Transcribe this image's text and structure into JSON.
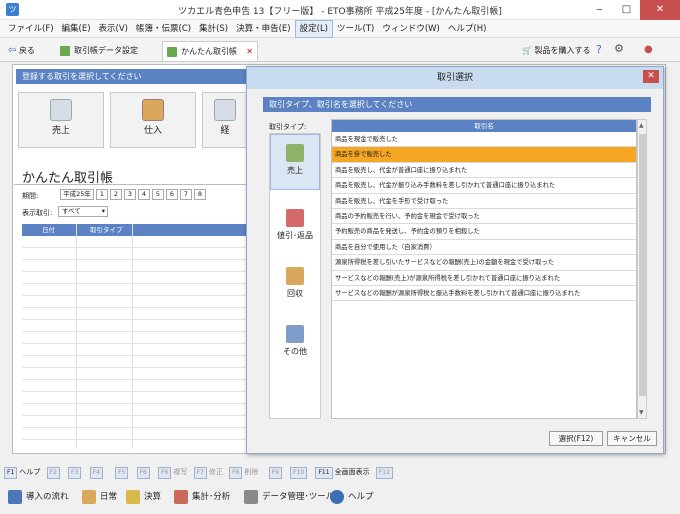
{
  "window": {
    "title": "ツカエル青色申告 13【フリー版】 - ETO事務所 平成25年度 - [かんたん取引帳]",
    "min_label": "‒",
    "max_label": "□",
    "close_label": "✕"
  },
  "menu": [
    "ファイル(F)",
    "編集(E)",
    "表示(V)",
    "帳簿・伝票(C)",
    "集計(S)",
    "決算・申告(E)",
    "設定(L)",
    "ツール(T)",
    "ウィンドウ(W)",
    "ヘルプ(H)"
  ],
  "toolbar": {
    "back_label": "戻る",
    "tab1": "取引帳データ設定",
    "tab2": "かんたん取引帳",
    "tab_close": "✕",
    "buy_label": "製品を購入する"
  },
  "main": {
    "instruction": "登録する取引を選択してください",
    "categories": [
      "売上",
      "仕入",
      "経"
    ],
    "page_title": "かんたん取引帳",
    "period_label": "期間:",
    "era_label": "平成25年",
    "months": [
      "1",
      "2",
      "3",
      "4",
      "5",
      "6",
      "7",
      "8"
    ],
    "filter_label": "表示取引:",
    "filter_value": "すべて",
    "grid_headers": [
      "日付",
      "取引タイプ"
    ]
  },
  "dialog": {
    "title": "取引選択",
    "close_label": "✕",
    "instruction": "取引タイプ、取引名を選択してください",
    "type_label": "取引タイプ:",
    "types": [
      "売上",
      "値引･返品",
      "回収",
      "その他"
    ],
    "list_header": "取引名",
    "rows": [
      "商品を現金で販売した",
      "商品を掛で販売した",
      "商品を販売し、代金が普通口座に振り込まれた",
      "商品を販売し、代金が振り込み手数料を差し引かれて普通口座に振り込まれた",
      "商品を販売し、代金を手形で受け取った",
      "商品の予約販売を行い、予約金を現金で受け取った",
      "予約販売の商品を発送し、予約金の預りを相殺した",
      "商品を自分で使用した（自家消費）",
      "源泉所得税を差し引いたサービスなどの報酬(売上)の金額を現金で受け取った",
      "サービスなどの報酬(売上)が源泉所得税を差し引かれて普通口座に振り込まれた",
      "サービスなどの報酬が源泉所得税と振込手数料を差し引かれて普通口座に振り込まれた"
    ],
    "selected_index": 1,
    "select_button": "選択(F12)",
    "cancel_button": "キャンセル"
  },
  "fkeys": [
    {
      "key": "F1",
      "label": "ヘルプ",
      "enabled": true
    },
    {
      "key": "F2",
      "label": "",
      "enabled": false
    },
    {
      "key": "F3",
      "label": "",
      "enabled": false
    },
    {
      "key": "F4",
      "label": "",
      "enabled": false
    },
    {
      "key": "F5",
      "label": "",
      "enabled": false
    },
    {
      "key": "F6",
      "label": "",
      "enabled": false
    },
    {
      "key": "F6",
      "label": "複写",
      "enabled": false
    },
    {
      "key": "F7",
      "label": "修正",
      "enabled": false
    },
    {
      "key": "F8",
      "label": "削除",
      "enabled": false
    },
    {
      "key": "F9",
      "label": "",
      "enabled": false
    },
    {
      "key": "F10",
      "label": "",
      "enabled": false
    },
    {
      "key": "F11",
      "label": "全画面表示",
      "enabled": true
    },
    {
      "key": "F12",
      "label": "",
      "enabled": false
    }
  ],
  "bottom": [
    "導入の流れ",
    "日常",
    "決算",
    "集計･分析",
    "データ管理･ツール",
    "ヘルプ"
  ],
  "icons": {
    "app": "app-icon",
    "help": "help-icon",
    "settings": "gear-icon",
    "cart": "cart-icon"
  }
}
